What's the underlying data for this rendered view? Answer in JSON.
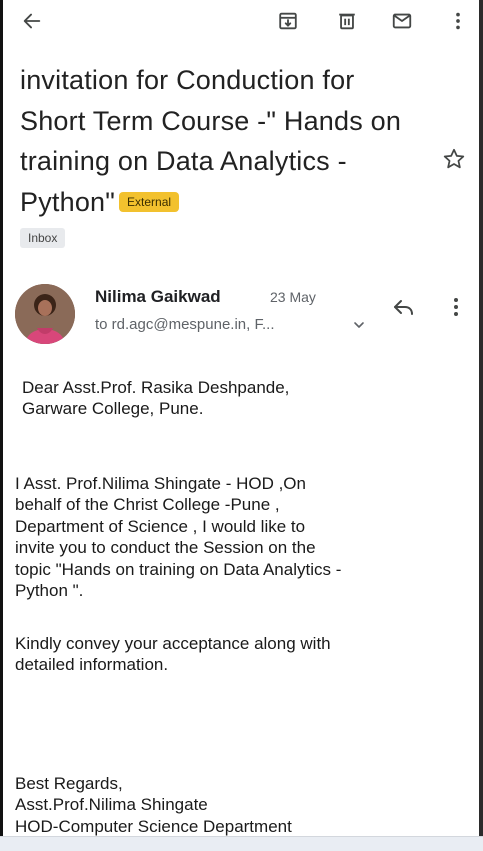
{
  "toolbar": {
    "back_icon": "arrow-left-icon",
    "archive_icon": "archive-icon",
    "delete_icon": "trash-icon",
    "mark_unread_icon": "mail-icon",
    "more_icon": "more-vert-icon"
  },
  "email": {
    "subject": "invitation for Conduction for Short Term Course -\" Hands on training on Data Analytics - Python\"",
    "external_badge": "External",
    "label": "Inbox",
    "starred": false,
    "sender": {
      "name": "Nilima Gaikwad",
      "date": "23 May",
      "recipients": "to rd.agc@mespune.in, F..."
    },
    "body": {
      "greeting": "Dear Asst.Prof. Rasika Deshpande,\nGarware College, Pune.",
      "paragraph1": "I Asst. Prof.Nilima Shingate - HOD ,On\nbehalf of the Christ College -Pune ,\nDepartment of Science , I would like to\ninvite you to conduct the Session on the\ntopic \"Hands on training on Data Analytics -\nPython \".",
      "paragraph2": "Kindly convey your acceptance along with\ndetailed information.",
      "closing": "Best Regards,\nAsst.Prof.Nilima Shingate\nHOD-Computer Science Department"
    }
  },
  "colors": {
    "badge_bg": "#f2c12e",
    "icon": "#444746",
    "text": "#202124",
    "muted": "#5f6368"
  }
}
